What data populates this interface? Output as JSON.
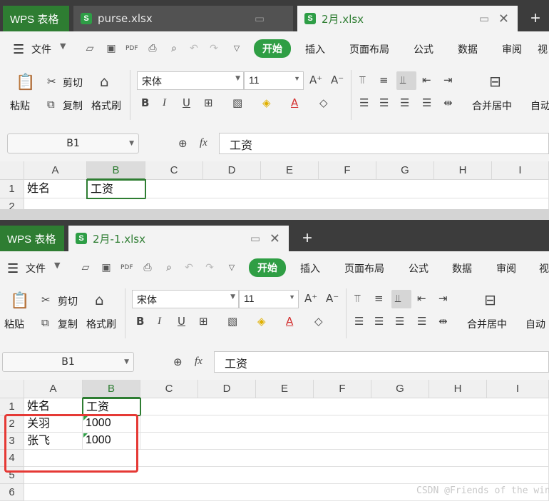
{
  "window1": {
    "tabs": [
      {
        "label": "WPS 表格"
      },
      {
        "label": "purse.xlsx",
        "icon": "S"
      },
      {
        "label": "2月.xlsx",
        "icon": "S"
      }
    ],
    "menu": [
      "文件",
      "开始",
      "插入",
      "页面布局",
      "公式",
      "数据",
      "审阅",
      "视"
    ],
    "ribbon": {
      "paste": "粘贴",
      "cut": "剪切",
      "copy": "复制",
      "format_painter": "格式刷",
      "font_name": "宋体",
      "font_size": "11",
      "merge_center": "合并居中",
      "auto": "自动"
    },
    "namebox": "B1",
    "formula": "工资",
    "columns": [
      "A",
      "B",
      "C",
      "D",
      "E",
      "F",
      "G",
      "H",
      "I"
    ],
    "rows": [
      "1",
      "2"
    ],
    "cells": {
      "a1": "姓名",
      "b1": "工资"
    }
  },
  "window2": {
    "tabs": [
      {
        "label": "WPS 表格"
      },
      {
        "label": "2月-1.xlsx",
        "icon": "S"
      }
    ],
    "menu": [
      "文件",
      "开始",
      "插入",
      "页面布局",
      "公式",
      "数据",
      "审阅",
      "视"
    ],
    "ribbon": {
      "paste": "粘贴",
      "cut": "剪切",
      "copy": "复制",
      "format_painter": "格式刷",
      "font_name": "宋体",
      "font_size": "11",
      "merge_center": "合并居中",
      "auto": "自动"
    },
    "namebox": "B1",
    "formula": "工资",
    "columns": [
      "A",
      "B",
      "C",
      "D",
      "E",
      "F",
      "G",
      "H",
      "I"
    ],
    "rows": [
      "1",
      "2",
      "3",
      "4",
      "5",
      "6"
    ],
    "cells": {
      "a1": "姓名",
      "b1": "工资",
      "a2": "关羽",
      "b2": "1000",
      "a3": "张飞",
      "b3": "1000"
    }
  },
  "watermark": "CSDN @Friends of the wind",
  "colors": {
    "accent": "#2e7d32",
    "annotation": "#e53935"
  }
}
